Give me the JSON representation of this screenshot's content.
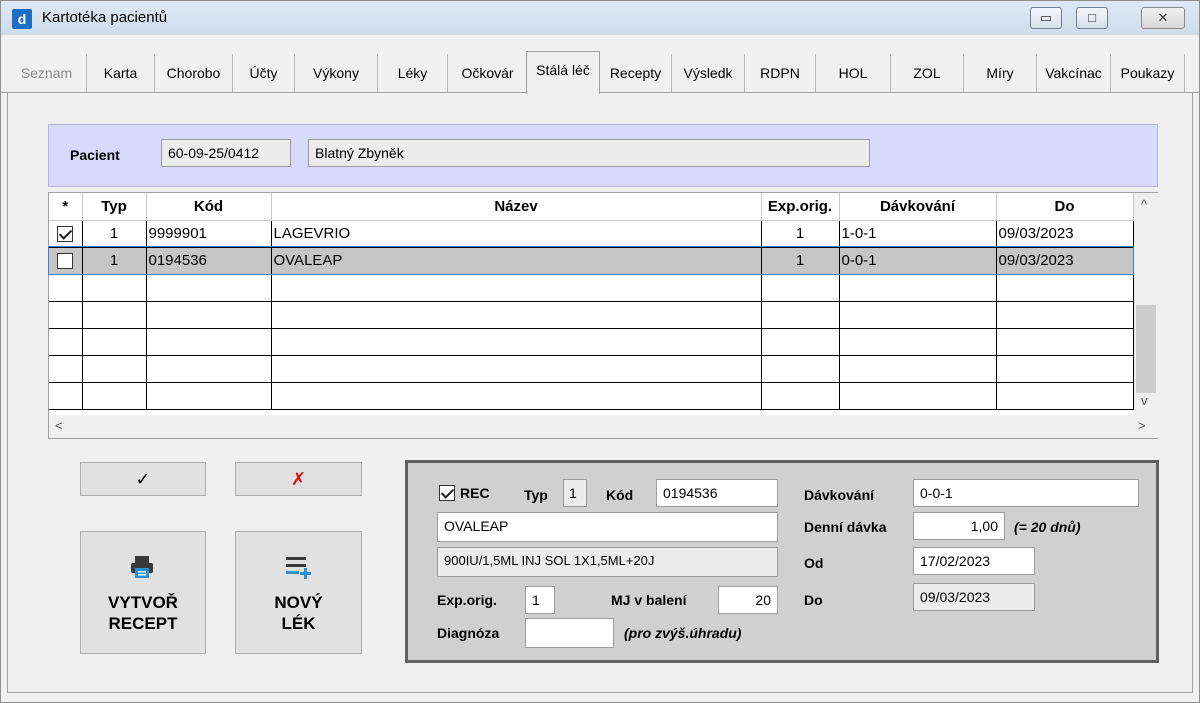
{
  "window": {
    "title": "Kartotéka pacientů",
    "icon": "app-icon",
    "icon_letter": "d",
    "controls": {
      "minimize": "▭",
      "maximize": "□",
      "close": "✕"
    }
  },
  "tabs": [
    {
      "label": "Seznam",
      "state": "disabled"
    },
    {
      "label": "Karta"
    },
    {
      "label": "Chorobo"
    },
    {
      "label": "Účty"
    },
    {
      "label": "Výkony"
    },
    {
      "label": "Léky"
    },
    {
      "label": "Očkovár"
    },
    {
      "label": "Stálá léč",
      "state": "active"
    },
    {
      "label": "Recepty"
    },
    {
      "label": "Výsledk"
    },
    {
      "label": "RDPN"
    },
    {
      "label": "HOL"
    },
    {
      "label": "ZOL"
    },
    {
      "label": "Míry"
    },
    {
      "label": "Vakcínac"
    },
    {
      "label": "Poukazy"
    }
  ],
  "patient": {
    "label": "Pacient",
    "id": "60-09-25/0412",
    "name": "Blatný Zbyněk"
  },
  "grid": {
    "headers": [
      "*",
      "Typ",
      "Kód",
      "Název",
      "Exp.orig.",
      "Dávkování",
      "Do"
    ],
    "rows": [
      {
        "checked": true,
        "typ": "1",
        "kod": "9999901",
        "nazev": "LAGEVRIO",
        "exp": "1",
        "davkovani": "1-0-1",
        "do": "09/03/2023",
        "selected": false
      },
      {
        "checked": false,
        "typ": "1",
        "kod": "0194536",
        "nazev": "OVALEAP",
        "exp": "1",
        "davkovani": "0-0-1",
        "do": "09/03/2023",
        "selected": true
      }
    ],
    "empty_rows": 5,
    "scroll": {
      "up": "^",
      "down": "v",
      "left": "<",
      "right": ">"
    }
  },
  "buttons": {
    "confirm_icon": "✓",
    "cancel_icon": "✗",
    "create_recipe_line1": "VYTVOŘ",
    "create_recipe_line2": "RECEPT",
    "new_drug_line1": "NOVÝ",
    "new_drug_line2": "LÉK"
  },
  "detail": {
    "rec_label": "REC",
    "rec_checked": true,
    "typ_label": "Typ",
    "typ_value": "1",
    "kod_label": "Kód",
    "kod_value": "0194536",
    "name_value": "OVALEAP",
    "description_value": "900IU/1,5ML INJ SOL 1X1,5ML+20J",
    "exp_label": "Exp.orig.",
    "exp_value": "1",
    "mj_label": "MJ v balení",
    "mj_value": "20",
    "diag_label": "Diagnóza",
    "diag_value": "",
    "diag_note": "(pro zvýš.úhradu)",
    "davkovani_label": "Dávkování",
    "davkovani_value": "0-0-1",
    "denni_label": "Denní dávka",
    "denni_value": "1,00",
    "denni_note": "(= 20 dnů)",
    "od_label": "Od",
    "od_value": "17/02/2023",
    "do_label": "Do",
    "do_value": "09/03/2023"
  }
}
